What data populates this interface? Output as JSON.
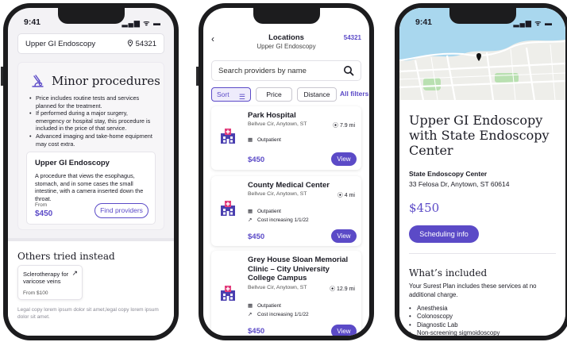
{
  "status": {
    "time": "9:41",
    "signal": "▂▄▆ ᯤ ▬"
  },
  "colors": {
    "accent": "#5b4ac7",
    "map_water": "#a9d7ee",
    "map_land": "#eeeeea",
    "map_park": "#b9e0b1"
  },
  "screen1": {
    "search_query": "Upper GI Endoscopy",
    "zip": "54321",
    "location_icon": "location-pin-icon",
    "procedures_title": "Minor procedures",
    "procedures_icon": "microscope-icon",
    "bullets": [
      "Price includes routine tests and services planned for the treatment.",
      "If performed during a major surgery, emergency or hospital stay, this procedure is included in the price of that service.",
      "Advanced imaging and take-home equipment may cost extra."
    ],
    "procedure": {
      "name": "Upper GI Endoscopy",
      "description": "A procedure that views the esophagus, stomach, and in some cases the small intestine, with a camera inserted down the throat.",
      "from_label": "From",
      "price": "$450",
      "button": "Find providers"
    },
    "others_title": "Others tried instead",
    "alternative": {
      "name": "Sclerotherapy for varicose veins",
      "arrow": "↗",
      "from": "From $100"
    },
    "legal": "Legal copy lorem ipsum dolor sit amet,legal copy lorem ipsum dolor sit amet."
  },
  "screen2": {
    "back": "‹",
    "title": "Locations",
    "subtitle": "Upper GI Endoscopy",
    "zip": "54321",
    "search_placeholder": "Search providers by name",
    "filters": {
      "sort": "Sort",
      "price": "Price",
      "distance": "Distance",
      "all": "All filters"
    },
    "providers": [
      {
        "name": "Park Hospital",
        "address": "Bellvue Cir, Anytown, ST",
        "distance": "7.9 mi",
        "type": "Outpatient",
        "note": "",
        "price": "$450",
        "action": "View"
      },
      {
        "name": "County Medical Center",
        "address": "Bellvue Cir, Anytown, ST",
        "distance": "4 mi",
        "type": "Outpatient",
        "note": "Cost increasing 1/1/22",
        "price": "$450",
        "action": "View"
      },
      {
        "name": "Grey House Sloan Memorial Clinic – City University College Campus",
        "address": "Bellvue Cir, Anytown, ST",
        "distance": "12.9 mi",
        "type": "Outpatient",
        "note": "Cost increasing 1/1/22",
        "price": "$450",
        "action": "View"
      }
    ]
  },
  "screen3": {
    "title": "Upper GI Endoscopy with State Endoscopy Center",
    "provider": "State Endoscopy Center",
    "address": "33 Felosa Dr, Anytown, ST 60614",
    "price": "$450",
    "button": "Scheduling info",
    "included_title": "What’s included",
    "included_desc": "Your Surest Plan includes these services at no additional charge.",
    "included": [
      "Anesthesia",
      "Colonoscopy",
      "Diagnostic Lab",
      "Non-screening sigmoidoscopy"
    ]
  }
}
